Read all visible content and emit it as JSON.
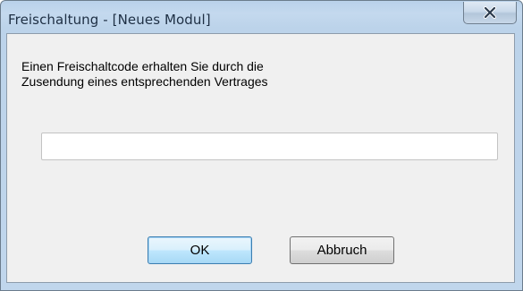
{
  "window": {
    "title": "Freischaltung - [Neues Modul]",
    "close_icon": "close-icon"
  },
  "dialog": {
    "message_line1": "Einen Freischaltcode erhalten Sie durch die",
    "message_line2": "Zusendung eines entsprechenden Vertrages",
    "code_input": {
      "value": "",
      "placeholder": ""
    },
    "ok_label": "OK",
    "cancel_label": "Abbruch"
  },
  "colors": {
    "titlebar": "#c0d6ec",
    "client": "#f0f0f0",
    "default_button_border": "#3c7fb1"
  }
}
